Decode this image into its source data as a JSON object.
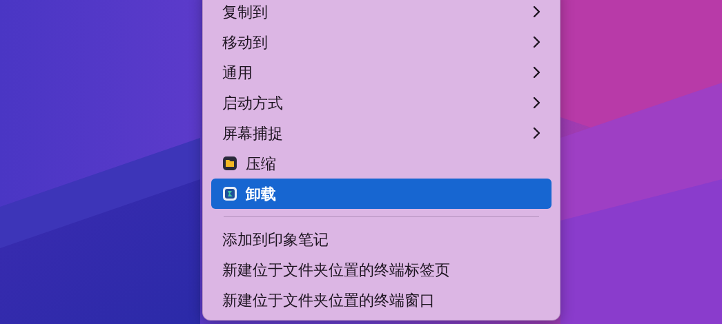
{
  "menu": {
    "items": [
      {
        "kind": "submenu",
        "label": "复制到",
        "selected": false
      },
      {
        "kind": "submenu",
        "label": "移动到",
        "selected": false
      },
      {
        "kind": "submenu",
        "label": "通用",
        "selected": false
      },
      {
        "kind": "submenu",
        "label": "启动方式",
        "selected": false
      },
      {
        "kind": "submenu",
        "label": "屏幕捕捉",
        "selected": false
      },
      {
        "kind": "app",
        "label": "压缩",
        "selected": false
      },
      {
        "kind": "app",
        "label": "卸载",
        "selected": true
      },
      {
        "kind": "separator"
      },
      {
        "kind": "plain",
        "label": "添加到印象笔记",
        "selected": false
      },
      {
        "kind": "plain",
        "label": "新建位于文件夹位置的终端标签页",
        "selected": false
      },
      {
        "kind": "plain",
        "label": "新建位于文件夹位置的终端窗口",
        "selected": false
      }
    ]
  }
}
